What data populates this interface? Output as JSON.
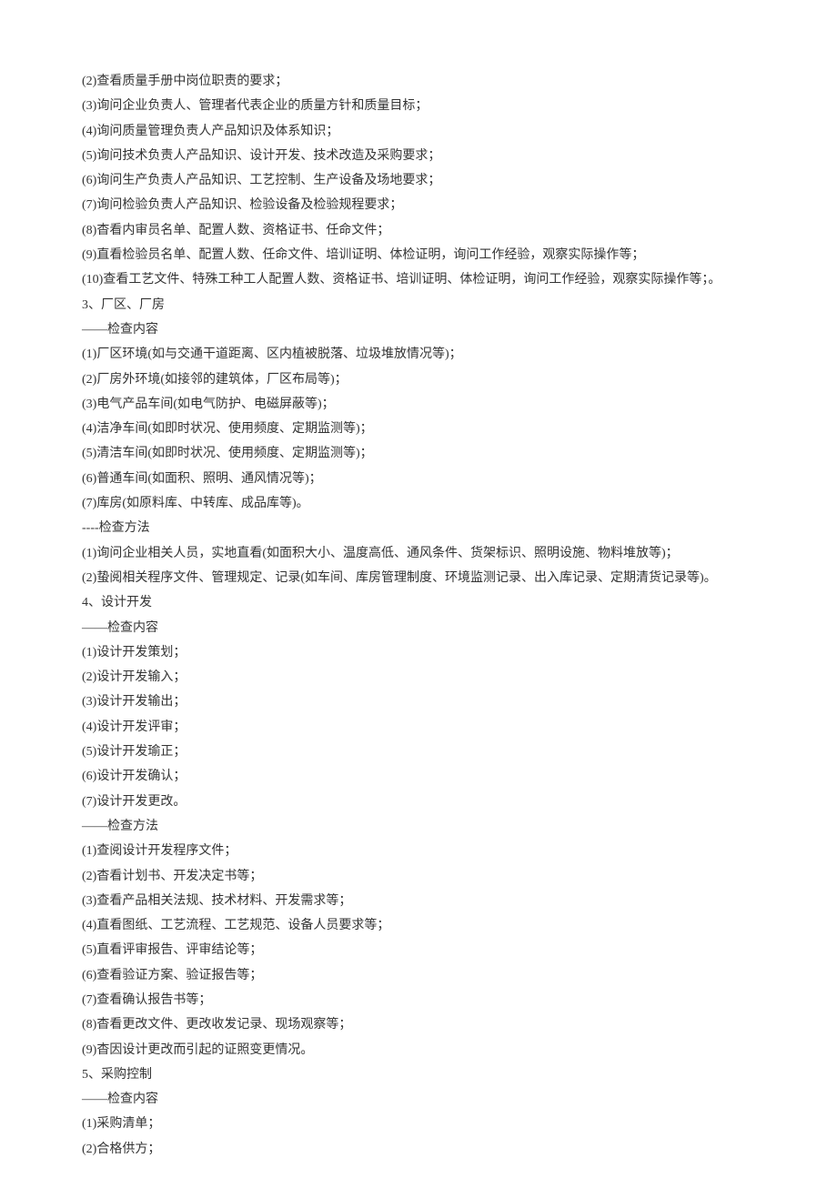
{
  "lines": [
    "(2)查看质量手册中岗位职责的要求；",
    "(3)询问企业负责人、管理者代表企业的质量方针和质量目标；",
    "(4)询问质量管理负责人产品知识及体系知识；",
    "(5)询问技术负责人产品知识、设计开发、技术改造及采购要求；",
    "(6)询问生产负责人产品知识、工艺控制、生产设备及场地要求；",
    "(7)询问检验负责人产品知识、检验设备及检验规程要求；",
    "(8)杳看内审员名单、配置人数、资格证书、任命文件；",
    "(9)直看检验员名单、配置人数、任命文件、培训证明、体检证明，询问工作经验，观察实际操作等；",
    "(10)查看工艺文件、特殊工种工人配置人数、资格证书、培训证明、体检证明，询问工作经验，观察实际操作等；。",
    "3、厂区、厂房",
    "——检查内容",
    "(1)厂区环境(如与交通干道距离、区内植被脱落、垃圾堆放情况等)；",
    "(2)厂房外环境(如接邻的建筑体，厂区布局等)；",
    "(3)电气产品车间(如电气防护、电磁屏蔽等)；",
    "(4)洁净车间(如即时状况、使用频度、定期监测等)；",
    "(5)清洁车间(如即时状况、使用频度、定期监测等)；",
    "(6)普通车间(如面积、照明、通风情况等)；",
    "(7)库房(如原料库、中转库、成品库等)。",
    "----检查方法",
    "(1)询问企业相关人员，实地直看(如面积大小、温度高低、通风条件、货架标识、照明设施、物料堆放等)；",
    "(2)蛰阅相关程序文件、管理规定、记录(如车间、库房管理制度、环境监测记录、出入库记录、定期清货记录等)。",
    "4、设计开发",
    "——检查内容",
    "(1)设计开发策划；",
    "(2)设计开发输入；",
    "(3)设计开发输出；",
    "(4)设计开发评审；",
    "(5)设计开发瑜正；",
    "(6)设计开发确认；",
    "(7)设计开发更改。",
    "——检查方法",
    "(1)查阅设计开发程序文件；",
    "(2)杳看计划书、开发决定书等；",
    "(3)查看产品相关法规、技术材料、开发需求等；",
    "(4)直看图纸、工艺流程、工艺规范、设备人员要求等；",
    "(5)直看评审报告、评审结论等；",
    "(6)查看验证方案、验证报告等；",
    "(7)查看确认报告书等；",
    "(8)杳看更改文件、更改收发记录、现场观察等；",
    "(9)杳因设计更改而引起的证照变更情况。",
    "5、采购控制",
    "——检查内容",
    "(1)采购清单；",
    "(2)合格供方；"
  ]
}
